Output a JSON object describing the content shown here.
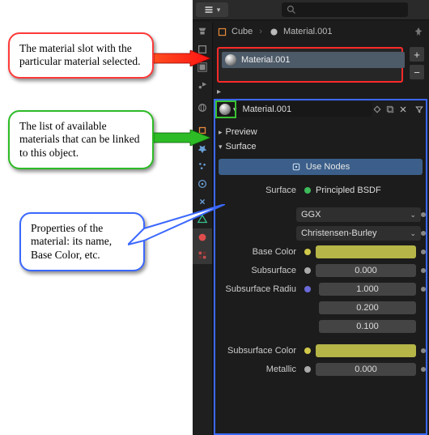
{
  "topbar": {
    "search_placeholder": ""
  },
  "crumb": {
    "object": "Cube",
    "material": "Material.001"
  },
  "slot": {
    "name": "Material.001"
  },
  "material": {
    "name": "Material.001"
  },
  "sections": {
    "preview": "Preview",
    "surface": "Surface"
  },
  "use_nodes_label": "Use Nodes",
  "props": {
    "surface": {
      "label": "Surface",
      "value": "Principled BSDF"
    },
    "dist": {
      "value": "GGX"
    },
    "sss": {
      "value": "Christensen-Burley"
    },
    "basecolor": {
      "label": "Base Color",
      "color": "#e4e45a"
    },
    "subsurface": {
      "label": "Subsurface",
      "value": "0.000"
    },
    "subsurface_radius": {
      "label": "Subsurface Radiu",
      "v1": "1.000",
      "v2": "0.200",
      "v3": "0.100"
    },
    "subsurface_color": {
      "label": "Subsurface Color",
      "color": "#e4e45a"
    },
    "metallic": {
      "label": "Metallic",
      "value": "0.000"
    }
  },
  "callouts": {
    "c1": "The material slot with the particular material selected.",
    "c2": "The list of available materials that can be linked to this object.",
    "c3": "Properties of the material: its name, Base Color, etc."
  }
}
